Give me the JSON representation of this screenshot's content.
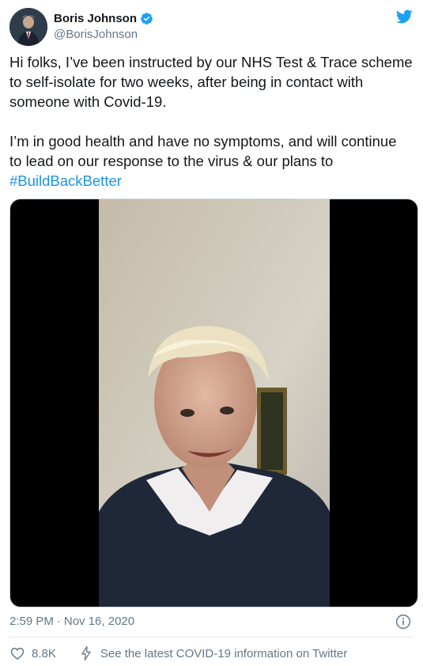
{
  "tweet": {
    "author": {
      "display_name": "Boris Johnson",
      "handle": "@BorisJohnson",
      "verified": true,
      "avatar_icon": "profile-photo"
    },
    "brand_icon": "twitter-bird-icon",
    "text_paragraph_1": "Hi folks, I’ve been instructed by our NHS Test & Trace scheme to self-isolate for two weeks, after being in contact with someone with Covid-19.",
    "text_paragraph_2_prefix": "I’m in good health and have no symptoms, and will continue to lead on our response to the virus & our plans to",
    "hashtag": "#BuildBackBetter",
    "media_type": "video",
    "time": "2:59 PM",
    "separator": "·",
    "date": "Nov 16, 2020",
    "likes": "8.8K",
    "covid_link": "See the latest COVID-19 information on Twitter"
  },
  "colors": {
    "text": "#14171a",
    "secondary": "#657786",
    "link": "#1b95e0",
    "brand": "#1da1f2"
  }
}
